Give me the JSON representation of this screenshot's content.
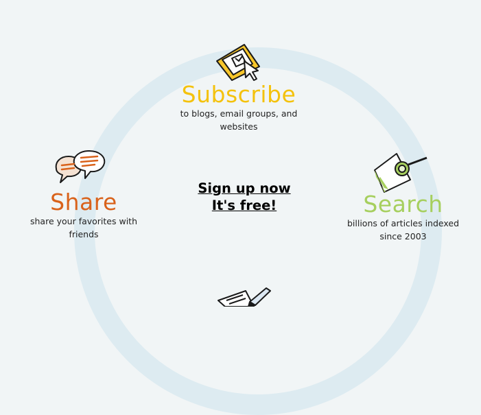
{
  "colors": {
    "background": "#f1f5f6",
    "ring": "#ddebf1",
    "subscribe": "#f4c20d",
    "share": "#d9621b",
    "search": "#a6cf5e"
  },
  "features": {
    "subscribe": {
      "title": "Subscribe",
      "desc_line1": "to blogs, email groups, and",
      "desc_line2": "websites",
      "icon": "subscribe-window-cursor-icon"
    },
    "share": {
      "title": "Share",
      "desc_line1": "share your favorites with",
      "desc_line2": "friends",
      "icon": "speech-bubbles-icon"
    },
    "search": {
      "title": "Search",
      "desc_line1": "billions of articles indexed",
      "desc_line2": "since 2003",
      "icon": "magnifier-document-icon"
    },
    "post": {
      "icon": "pen-paper-icon"
    }
  },
  "signup": {
    "line1": "Sign up now",
    "line2": "It's free!"
  }
}
